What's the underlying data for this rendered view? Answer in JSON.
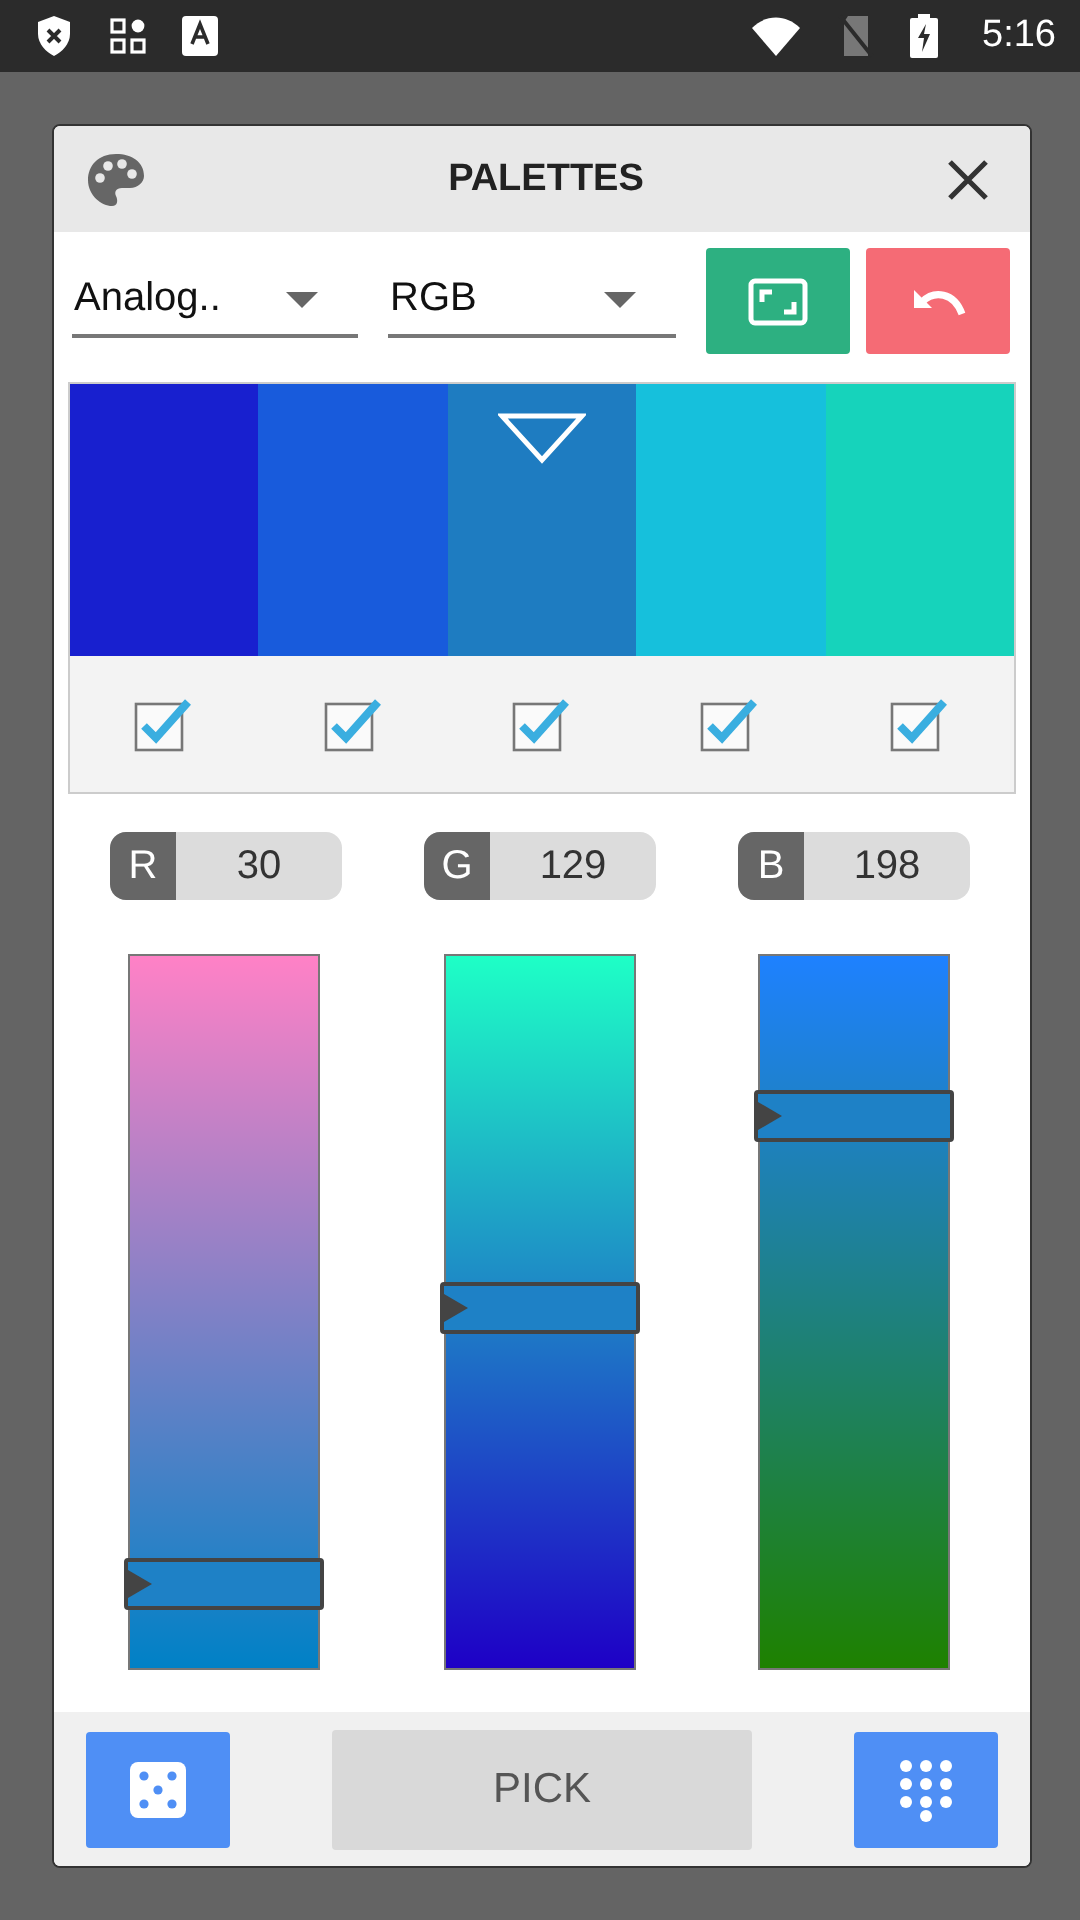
{
  "status_bar": {
    "time": "5:16"
  },
  "dialog": {
    "title": "PALETTES",
    "scheme_dropdown": {
      "value": "Analog.."
    },
    "mode_dropdown": {
      "value": "RGB"
    },
    "swatches": [
      {
        "color": "#1820cf",
        "selected": false,
        "checked": true
      },
      {
        "color": "#185bdc",
        "selected": false,
        "checked": true
      },
      {
        "color": "#1e7cc1",
        "selected": true,
        "checked": true
      },
      {
        "color": "#16c0dc",
        "selected": false,
        "checked": true
      },
      {
        "color": "#16d3bb",
        "selected": false,
        "checked": true
      }
    ],
    "channels": [
      {
        "label": "R",
        "value": "30",
        "level": 0.118
      },
      {
        "label": "G",
        "value": "129",
        "level": 0.506
      },
      {
        "label": "B",
        "value": "198",
        "level": 0.776
      }
    ],
    "pick_button": "PICK"
  }
}
